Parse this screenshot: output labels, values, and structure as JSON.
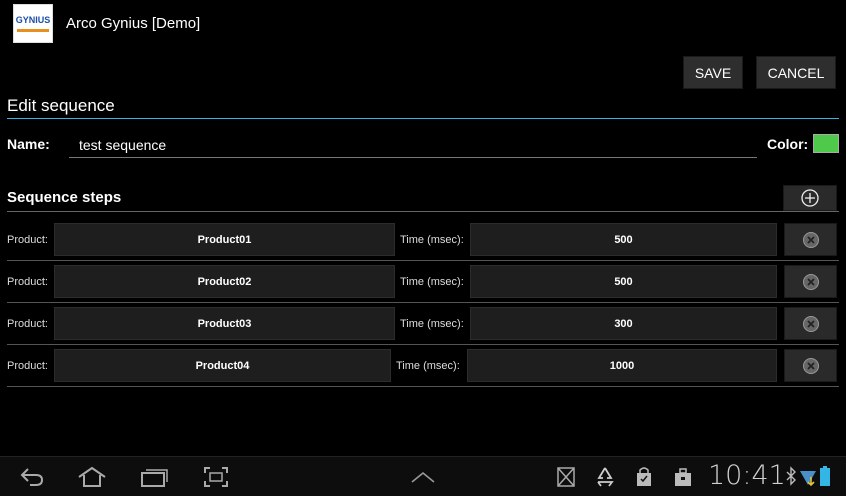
{
  "app": {
    "title": "Arco Gynius [Demo]",
    "logo_text": "GYNIUS"
  },
  "toolbar": {
    "save_label": "SAVE",
    "cancel_label": "CANCEL"
  },
  "form": {
    "heading": "Edit sequence",
    "name_label": "Name:",
    "name_value": "test sequence",
    "color_label": "Color:",
    "color_value": "#4fc94a"
  },
  "steps": {
    "heading": "Sequence steps",
    "add_icon": "add-circle-icon",
    "delete_icon": "remove-circle-icon",
    "rows": [
      {
        "product_label": "Product:",
        "product": "Product01",
        "time_label": "Time (msec):",
        "time": "500"
      },
      {
        "product_label": "Product:",
        "product": "Product02",
        "time_label": "Time (msec):",
        "time": "500"
      },
      {
        "product_label": "Product:",
        "product": "Product03",
        "time_label": "Time (msec):",
        "time": "300"
      },
      {
        "product_label": "Product:",
        "product": "Product04",
        "time_label": "Time (msec):",
        "time": "1000"
      }
    ]
  },
  "system_bar": {
    "clock": "10:41",
    "nav_icons": [
      "back-icon",
      "home-icon",
      "recent-apps-icon",
      "screenshot-icon",
      "menu-up-icon"
    ],
    "status_icons": [
      "no-sim-icon",
      "recycle-icon",
      "shopping-bag-icon",
      "briefcase-icon",
      "bluetooth-icon",
      "wifi-icon",
      "battery-icon"
    ]
  }
}
